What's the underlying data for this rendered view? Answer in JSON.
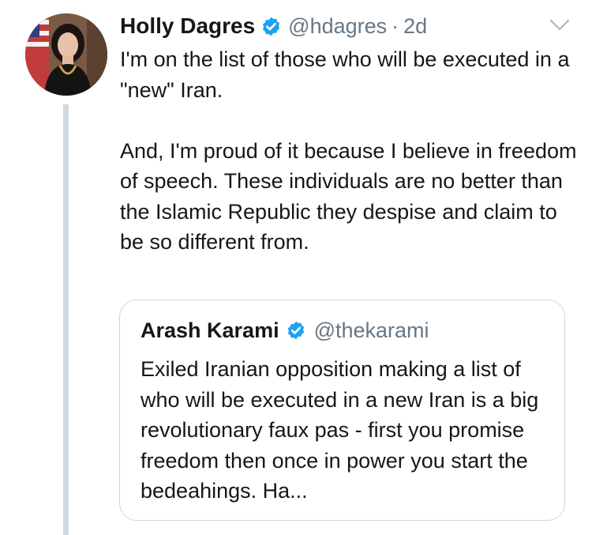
{
  "tweet": {
    "author_name": "Holly Dagres",
    "handle": "@hdagres",
    "separator": "·",
    "time": "2d",
    "paragraphs": [
      "I'm on the list of those who will be executed in a \"new\" Iran.",
      "And, I'm proud of it because I believe in freedom of speech. These individuals are no better than the Islamic Republic they despise and claim to be so different from."
    ]
  },
  "quoted_tweet": {
    "author_name": "Arash Karami",
    "handle": "@thekarami",
    "text": "Exiled Iranian opposition making a list of who will be executed in a new Iran is a big revolutionary faux pas - first you promise freedom then once in power you start the bedeahings. Ha..."
  },
  "icons": {
    "verified": "verified-badge-icon",
    "menu": "chevron-down-icon"
  },
  "colors": {
    "verified_blue": "#1da1f2",
    "secondary_text": "#657786",
    "primary_text": "#14171a",
    "thread_line": "#cfd9de",
    "card_border": "#ccd6dd"
  }
}
